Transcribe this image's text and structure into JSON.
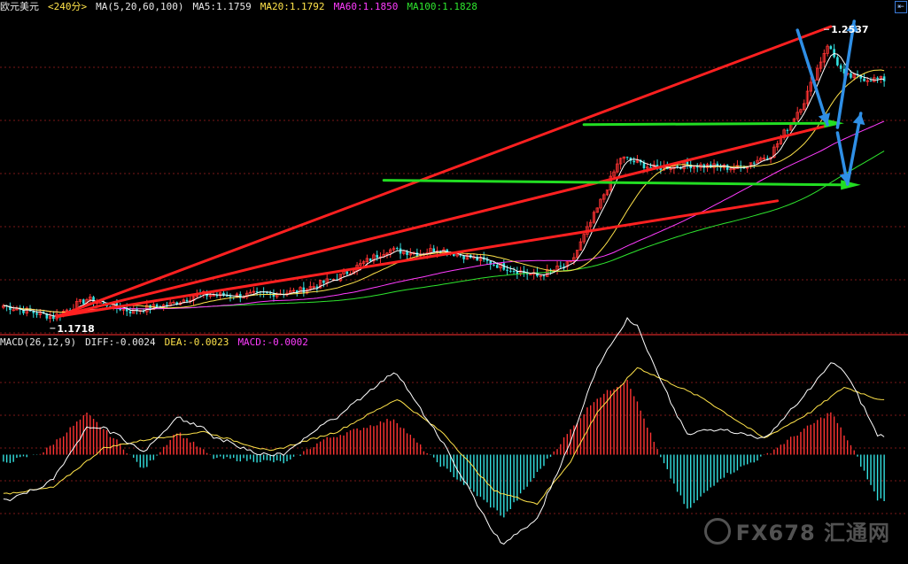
{
  "header": {
    "symbol": "欧元美元",
    "timeframe": "<240分>",
    "ma_label": "MA(5,20,60,100)",
    "ma5": "MA5:1.1759",
    "ma20": "MA20:1.1792",
    "ma60": "MA60:1.1850",
    "ma100": "MA100:1.1828"
  },
  "macd_header": {
    "label": "MACD(26,12,9)",
    "diff": "DIFF:-0.0024",
    "dea": "DEA:-0.0023",
    "macd": "MACD:-0.0002"
  },
  "watermark": {
    "text": "FX678 汇通网",
    "icon": "fx678-logo-icon"
  },
  "colors": {
    "up": "#ff3333",
    "down": "#33e0e0",
    "ma5": "#ffffff",
    "ma20": "#ffe34a",
    "ma60": "#ff3cff",
    "ma100": "#2ee62e",
    "trend_red": "#ff2020",
    "level_green": "#22dd22",
    "arrow_blue": "#2f8fe6",
    "grid": "#7a1818"
  },
  "chart_data": [
    {
      "type": "candlestick",
      "instrument": "欧元美元",
      "timeframe": "240分",
      "ylim": [
        1.168,
        1.258
      ],
      "grid": true,
      "annotations": [
        {
          "text": "1.1718",
          "kind": "low",
          "x_index": 15,
          "value": 1.1718
        },
        {
          "text": "1.2537",
          "kind": "high",
          "x_index": 247,
          "value": 1.2537
        }
      ],
      "keypoints": [
        [
          0,
          1.1757
        ],
        [
          15,
          1.1725
        ],
        [
          25,
          1.1775
        ],
        [
          38,
          1.1742
        ],
        [
          50,
          1.176
        ],
        [
          58,
          1.1788
        ],
        [
          70,
          1.1785
        ],
        [
          88,
          1.1796
        ],
        [
          100,
          1.1835
        ],
        [
          115,
          1.1915
        ],
        [
          125,
          1.1905
        ],
        [
          130,
          1.1918
        ],
        [
          145,
          1.188
        ],
        [
          160,
          1.184
        ],
        [
          170,
          1.1875
        ],
        [
          178,
          1.203
        ],
        [
          185,
          1.2175
        ],
        [
          195,
          1.2145
        ],
        [
          205,
          1.2155
        ],
        [
          220,
          1.2145
        ],
        [
          230,
          1.2185
        ],
        [
          240,
          1.2335
        ],
        [
          247,
          1.2495
        ],
        [
          252,
          1.2405
        ],
        [
          262,
          1.2395
        ]
      ],
      "moving_averages": [
        {
          "name": "MA5",
          "value": 1.1759
        },
        {
          "name": "MA20",
          "value": 1.1792
        },
        {
          "name": "MA60",
          "value": 1.185
        },
        {
          "name": "MA100",
          "value": 1.1828
        }
      ]
    },
    {
      "type": "macd",
      "params": "26,12,9",
      "diff": -0.0024,
      "dea": -0.0023,
      "macd": -0.0002,
      "ylim": [
        -0.016,
        0.016
      ],
      "histogram_keypoints": [
        [
          0,
          -0.0013
        ],
        [
          12,
          0.0004
        ],
        [
          25,
          0.0062
        ],
        [
          35,
          0.0016
        ],
        [
          42,
          -0.0023
        ],
        [
          52,
          0.0035
        ],
        [
          63,
          -0.0005
        ],
        [
          85,
          -0.0012
        ],
        [
          96,
          0.0023
        ],
        [
          117,
          0.0055
        ],
        [
          128,
          -0.0003
        ],
        [
          150,
          -0.0095
        ],
        [
          165,
          0.0005
        ],
        [
          177,
          0.0083
        ],
        [
          187,
          0.0115
        ],
        [
          197,
          -0.0005
        ],
        [
          205,
          -0.0085
        ],
        [
          215,
          -0.0035
        ],
        [
          228,
          -0.0002
        ],
        [
          248,
          0.0065
        ],
        [
          255,
          0.0005
        ],
        [
          262,
          -0.0068
        ]
      ],
      "dea_keypoints": [
        [
          0,
          -0.006
        ],
        [
          15,
          -0.005
        ],
        [
          30,
          0.001
        ],
        [
          45,
          0.0025
        ],
        [
          60,
          0.0035
        ],
        [
          80,
          0.0005
        ],
        [
          100,
          0.0035
        ],
        [
          118,
          0.0085
        ],
        [
          132,
          0.0032
        ],
        [
          147,
          -0.0055
        ],
        [
          160,
          -0.0075
        ],
        [
          170,
          -0.001
        ],
        [
          178,
          0.0065
        ],
        [
          190,
          0.0133
        ],
        [
          210,
          0.0085
        ],
        [
          228,
          0.0025
        ],
        [
          242,
          0.0065
        ],
        [
          252,
          0.0103
        ],
        [
          262,
          0.0085
        ]
      ]
    }
  ]
}
